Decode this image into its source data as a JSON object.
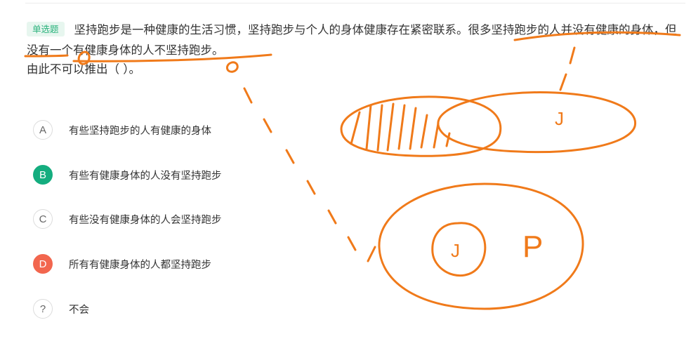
{
  "question": {
    "tag": "单选题",
    "stem": "坚持跑步是一种健康的生活习惯，坚持跑步与个人的身体健康存在紧密联系。很多坚持跑步的人并没有健康的身体，但没有一个有健康身体的人不坚持跑步。",
    "prompt": "由此不可以推出（  ）。"
  },
  "options": [
    {
      "letter": "A",
      "text": "有些坚持跑步的人有健康的身体",
      "state": "normal"
    },
    {
      "letter": "B",
      "text": "有些有健康身体的人没有坚持跑步",
      "state": "correct"
    },
    {
      "letter": "C",
      "text": "有些没有健康身体的人会坚持跑步",
      "state": "normal"
    },
    {
      "letter": "D",
      "text": "所有有健康身体的人都坚持跑步",
      "state": "wrong"
    },
    {
      "letter": "?",
      "text": "不会",
      "state": "normal"
    }
  ],
  "annotations": {
    "color": "#f07a1a",
    "labels": [
      "J",
      "P",
      "J",
      "o",
      "o"
    ]
  }
}
